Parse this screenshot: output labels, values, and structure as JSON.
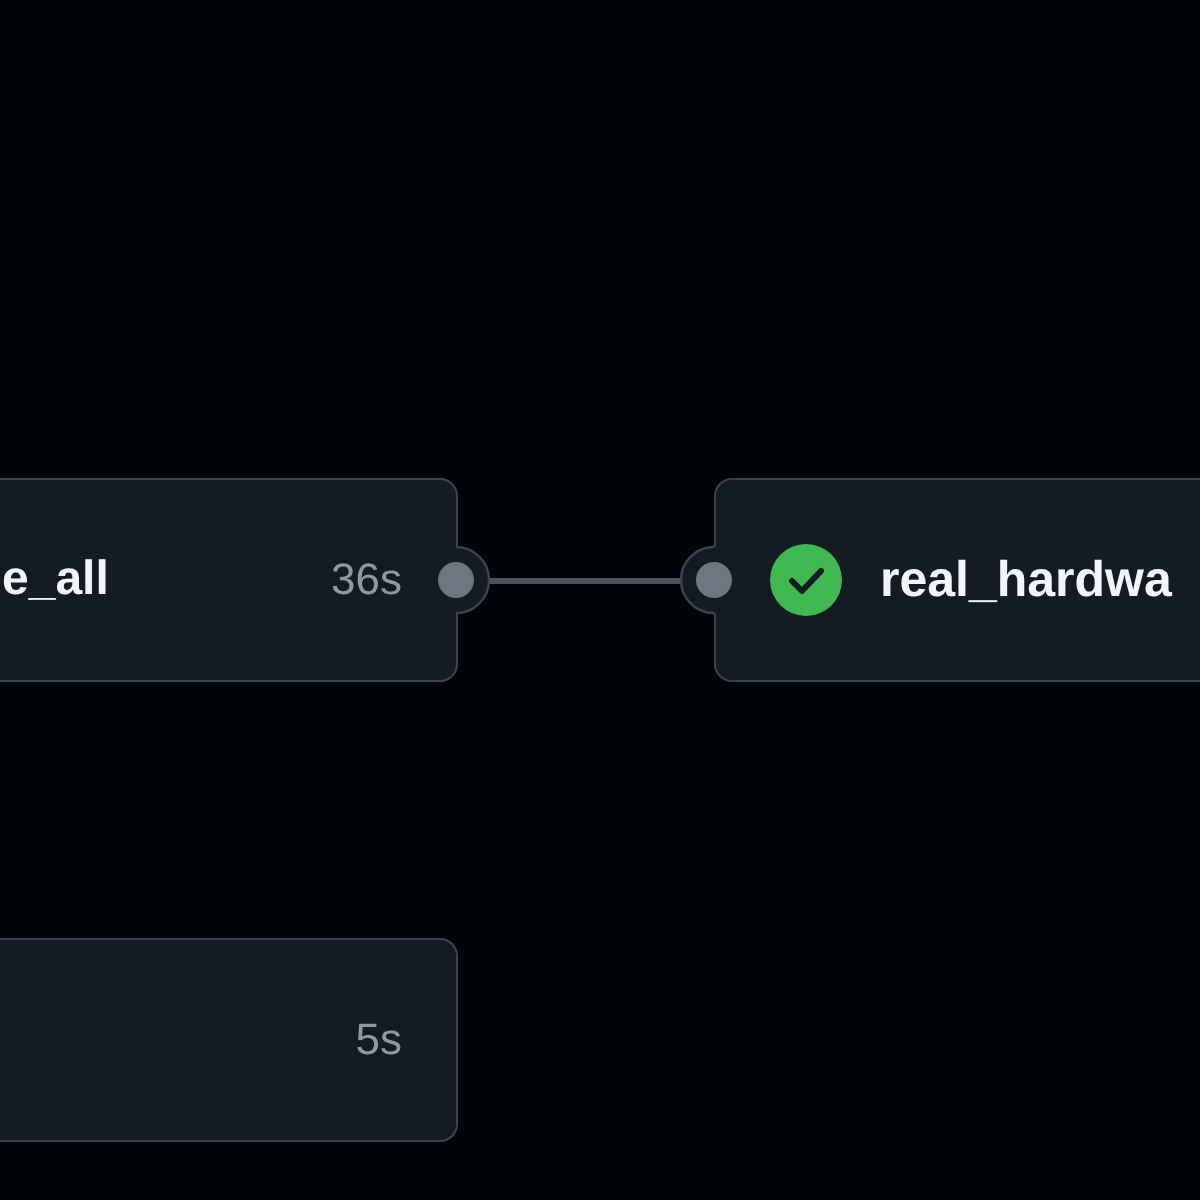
{
  "graph": {
    "nodes": [
      {
        "name": "e_all",
        "duration": "36s",
        "input_port": false,
        "output_port": true
      },
      {
        "name": "real_hardwa",
        "succeeded": true,
        "input_port": true,
        "output_port": false
      },
      {
        "duration": "5s",
        "input_port": false,
        "output_port": false
      }
    ]
  }
}
